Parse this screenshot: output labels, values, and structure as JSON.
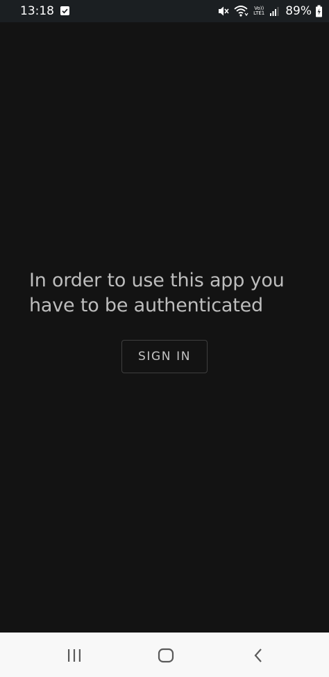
{
  "status_bar": {
    "time": "13:18",
    "network_label_top": "Vo))",
    "network_label_bottom": "LTE1",
    "battery_percent": "89%"
  },
  "main": {
    "message": "In order to use this app you have to be authenticated",
    "sign_in_label": "SIGN IN"
  },
  "nav_bar": {
    "icons": [
      "recents-icon",
      "home-icon",
      "back-icon"
    ]
  },
  "colors": {
    "background": "#131313",
    "status_bar": "#1b1f22",
    "nav_bar": "#f8f8f8",
    "text": "#bdbdbd"
  }
}
